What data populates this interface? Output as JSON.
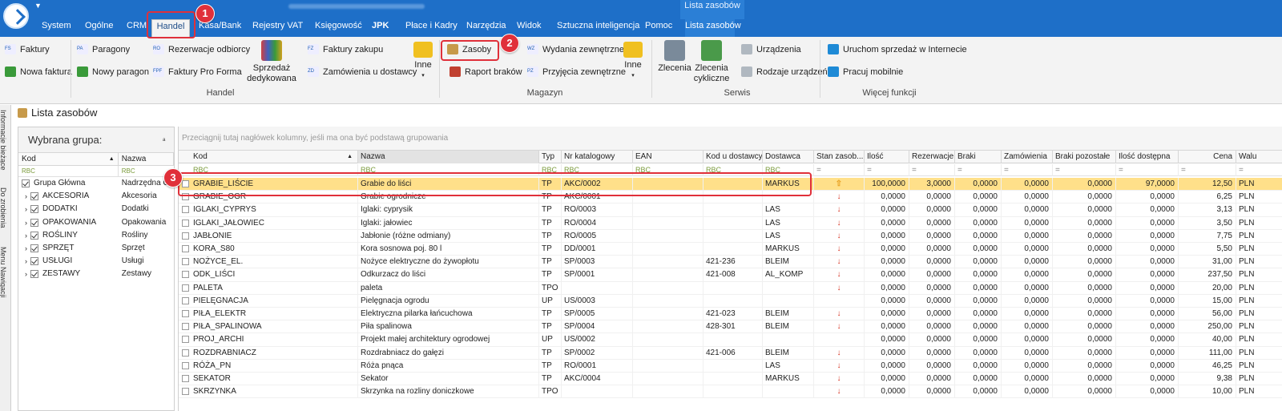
{
  "app": {
    "title_blurred": "",
    "context_header": "Lista zasobów"
  },
  "tabs": [
    {
      "label": "System",
      "active": false
    },
    {
      "label": "Ogólne",
      "active": false
    },
    {
      "label": "CRM",
      "active": false
    },
    {
      "label": "Handel",
      "active": true
    },
    {
      "label": "Kasa/Bank",
      "active": false
    },
    {
      "label": "Rejestry VAT",
      "active": false
    },
    {
      "label": "Księgowość",
      "active": false
    },
    {
      "label": "JPK",
      "active": false
    },
    {
      "label": "Płace i Kadry",
      "active": false
    },
    {
      "label": "Narzędzia",
      "active": false
    },
    {
      "label": "Widok",
      "active": false
    },
    {
      "label": "Sztuczna inteligencja",
      "active": false
    },
    {
      "label": "Pomoc",
      "active": false
    },
    {
      "label": "Lista zasobów",
      "active": false
    }
  ],
  "ribbon": {
    "faktury": "Faktury",
    "nowa_faktura": "Nowa faktura",
    "paragony": "Paragony",
    "nowy_paragon": "Nowy paragon",
    "rezerwacje": "Rezerwacje odbiorcy",
    "pro_forma": "Faktury Pro Forma",
    "sprzedaz_dedykowana": "Sprzedaż dedykowana",
    "faktury_zakupu": "Faktury zakupu",
    "zamowienia_dostawcy": "Zamówienia u dostawcy",
    "inne1": "Inne",
    "zasoby": "Zasoby",
    "raport_brakow": "Raport braków",
    "wydania_zewn": "Wydania zewnętrzne",
    "przyjecia_zewn": "Przyjęcia zewnętrzne",
    "inne2": "Inne",
    "zlecenia": "Zlecenia",
    "zlecenia_cykliczne": "Zlecenia cykliczne",
    "urzadzenia": "Urządzenia",
    "rodzaje_urzadzen": "Rodzaje urządzeń",
    "uruchom_sprzedaz": "Uruchom sprzedaż w Internecie",
    "pracuj_mobilnie": "Pracuj mobilnie",
    "groups": {
      "handel": "Handel",
      "magazyn": "Magazyn",
      "serwis": "Serwis",
      "wiecej": "Więcej funkcji"
    },
    "icons": {
      "faktury": "FS",
      "paragony": "PA",
      "rezerwacje": "RO",
      "pro_forma": "FPF",
      "faktury_zakupu": "FZ",
      "zamowienia": "ZD",
      "wydania": "WZ",
      "przyjecia": "PZ"
    }
  },
  "annotations": [
    "1",
    "2",
    "3"
  ],
  "side_tabs": [
    "Informacje bieżące",
    "Do zrobienia",
    "Menu Nawigacji"
  ],
  "panel_title": "Lista zasobów",
  "group_panel": {
    "title": "Wybrana grupa:",
    "col_kod": "Kod",
    "col_nazwa": "Nazwa",
    "filter_icon": "RBC",
    "rows": [
      {
        "kod": "Grupa Główna",
        "nazwa": "Nadrzędna Gr"
      },
      {
        "kod": "AKCESORIA",
        "nazwa": "Akcesoria"
      },
      {
        "kod": "DODATKI",
        "nazwa": "Dodatki"
      },
      {
        "kod": "OPAKOWANIA",
        "nazwa": "Opakowania"
      },
      {
        "kod": "ROŚLINY",
        "nazwa": "Rośliny"
      },
      {
        "kod": "SPRZĘT",
        "nazwa": "Sprzęt"
      },
      {
        "kod": "USŁUGI",
        "nazwa": "Usługi"
      },
      {
        "kod": "ZESTAWY",
        "nazwa": "Zestawy"
      }
    ]
  },
  "grid": {
    "group_hint": "Przeciągnij tutaj nagłówek kolumny, jeśli ma ona być podstawą grupowania",
    "columns": [
      "Kod",
      "Nazwa",
      "Typ",
      "Nr katalogowy",
      "EAN",
      "Kod u dostawcy",
      "Dostawca",
      "Stan zasob...",
      "Ilość",
      "Rezerwacje",
      "Braki",
      "Zamówienia",
      "Braki pozostałe",
      "Ilość dostępna",
      "Cena",
      "Walu"
    ],
    "rows": [
      [
        "GRABIE_LIŚCIE",
        "Grabie do liści",
        "TP",
        "AKC/0002",
        "",
        "",
        "MARKUS",
        "up",
        "100,0000",
        "3,0000",
        "0,0000",
        "0,0000",
        "0,0000",
        "97,0000",
        "12,50",
        "PLN"
      ],
      [
        "GRABIE_OGR",
        "Grabie ogrodnicze",
        "TP",
        "AKC/0001",
        "",
        "",
        "",
        "down",
        "0,0000",
        "0,0000",
        "0,0000",
        "0,0000",
        "0,0000",
        "0,0000",
        "6,25",
        "PLN"
      ],
      [
        "IGLAKI_CYPRYS",
        "Iglaki: cyprysik",
        "TP",
        "RO/0003",
        "",
        "",
        "LAS",
        "down",
        "0,0000",
        "0,0000",
        "0,0000",
        "0,0000",
        "0,0000",
        "0,0000",
        "3,13",
        "PLN"
      ],
      [
        "IGLAKI_JAŁOWIEC",
        "Iglaki: jałowiec",
        "TP",
        "RO/0004",
        "",
        "",
        "LAS",
        "down",
        "0,0000",
        "0,0000",
        "0,0000",
        "0,0000",
        "0,0000",
        "0,0000",
        "3,50",
        "PLN"
      ],
      [
        "JABŁONIE",
        "Jabłonie (różne odmiany)",
        "TP",
        "RO/0005",
        "",
        "",
        "LAS",
        "down",
        "0,0000",
        "0,0000",
        "0,0000",
        "0,0000",
        "0,0000",
        "0,0000",
        "7,75",
        "PLN"
      ],
      [
        "KORA_S80",
        "Kora sosnowa poj. 80 l",
        "TP",
        "DD/0001",
        "",
        "",
        "MARKUS",
        "down",
        "0,0000",
        "0,0000",
        "0,0000",
        "0,0000",
        "0,0000",
        "0,0000",
        "5,50",
        "PLN"
      ],
      [
        "NOŻYCE_EL.",
        "Nożyce elektryczne do żywopłotu",
        "TP",
        "SP/0003",
        "",
        "421-236",
        "BLEIM",
        "down",
        "0,0000",
        "0,0000",
        "0,0000",
        "0,0000",
        "0,0000",
        "0,0000",
        "31,00",
        "PLN"
      ],
      [
        "ODK_LIŚCI",
        "Odkurzacz do liści",
        "TP",
        "SP/0001",
        "",
        "421-008",
        "AL_KOMP",
        "down",
        "0,0000",
        "0,0000",
        "0,0000",
        "0,0000",
        "0,0000",
        "0,0000",
        "237,50",
        "PLN"
      ],
      [
        "PALETA",
        "paleta",
        "TPO",
        "",
        "",
        "",
        "",
        "down",
        "0,0000",
        "0,0000",
        "0,0000",
        "0,0000",
        "0,0000",
        "0,0000",
        "20,00",
        "PLN"
      ],
      [
        "PIELĘGNACJA",
        "Pielęgnacja ogrodu",
        "UP",
        "US/0003",
        "",
        "",
        "",
        "",
        "0,0000",
        "0,0000",
        "0,0000",
        "0,0000",
        "0,0000",
        "0,0000",
        "15,00",
        "PLN"
      ],
      [
        "PIŁA_ELEKTR",
        "Elektryczna pilarka łańcuchowa",
        "TP",
        "SP/0005",
        "",
        "421-023",
        "BLEIM",
        "down",
        "0,0000",
        "0,0000",
        "0,0000",
        "0,0000",
        "0,0000",
        "0,0000",
        "56,00",
        "PLN"
      ],
      [
        "PIŁA_SPALINOWA",
        "Piła spalinowa",
        "TP",
        "SP/0004",
        "",
        "428-301",
        "BLEIM",
        "down",
        "0,0000",
        "0,0000",
        "0,0000",
        "0,0000",
        "0,0000",
        "0,0000",
        "250,00",
        "PLN"
      ],
      [
        "PROJ_ARCHI",
        "Projekt małej architektury ogrodowej",
        "UP",
        "US/0002",
        "",
        "",
        "",
        "",
        "0,0000",
        "0,0000",
        "0,0000",
        "0,0000",
        "0,0000",
        "0,0000",
        "40,00",
        "PLN"
      ],
      [
        "ROZDRABNIACZ",
        "Rozdrabniacz do gałęzi",
        "TP",
        "SP/0002",
        "",
        "421-006",
        "BLEIM",
        "down",
        "0,0000",
        "0,0000",
        "0,0000",
        "0,0000",
        "0,0000",
        "0,0000",
        "111,00",
        "PLN"
      ],
      [
        "RÓŻA_PN",
        "Róża pnąca",
        "TP",
        "RO/0001",
        "",
        "",
        "LAS",
        "down",
        "0,0000",
        "0,0000",
        "0,0000",
        "0,0000",
        "0,0000",
        "0,0000",
        "46,25",
        "PLN"
      ],
      [
        "SEKATOR",
        "Sekator",
        "TP",
        "AKC/0004",
        "",
        "",
        "MARKUS",
        "down",
        "0,0000",
        "0,0000",
        "0,0000",
        "0,0000",
        "0,0000",
        "0,0000",
        "9,38",
        "PLN"
      ],
      [
        "SKRZYNKA",
        "Skrzynka na rozliny doniczkowe",
        "TPO",
        "",
        "",
        "",
        "",
        "down",
        "0,0000",
        "0,0000",
        "0,0000",
        "0,0000",
        "0,0000",
        "0,0000",
        "10,00",
        "PLN"
      ]
    ]
  },
  "colors": {
    "title_blue": "#1e6fc8",
    "selected_row": "#ffe08a",
    "annot_red": "#e0303a",
    "arrow_red": "#d63020"
  }
}
